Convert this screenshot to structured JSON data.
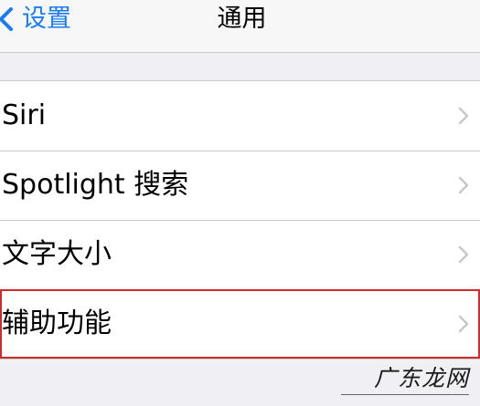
{
  "nav": {
    "back_label": "设置",
    "title": "通用"
  },
  "rows": [
    {
      "label": "Siri",
      "highlighted": false
    },
    {
      "label": "Spotlight 搜索",
      "highlighted": false
    },
    {
      "label": "文字大小",
      "highlighted": false
    },
    {
      "label": "辅助功能",
      "highlighted": true
    }
  ],
  "watermark": {
    "text": "广东龙网"
  },
  "colors": {
    "accent": "#1a7cf5",
    "background": "#efeff4",
    "highlight_border": "#d42a2a",
    "separator": "#c8c7cc",
    "chevron": "#c7c7cc"
  },
  "icons": {
    "back": "chevron-left-icon",
    "row": "chevron-right-icon"
  }
}
